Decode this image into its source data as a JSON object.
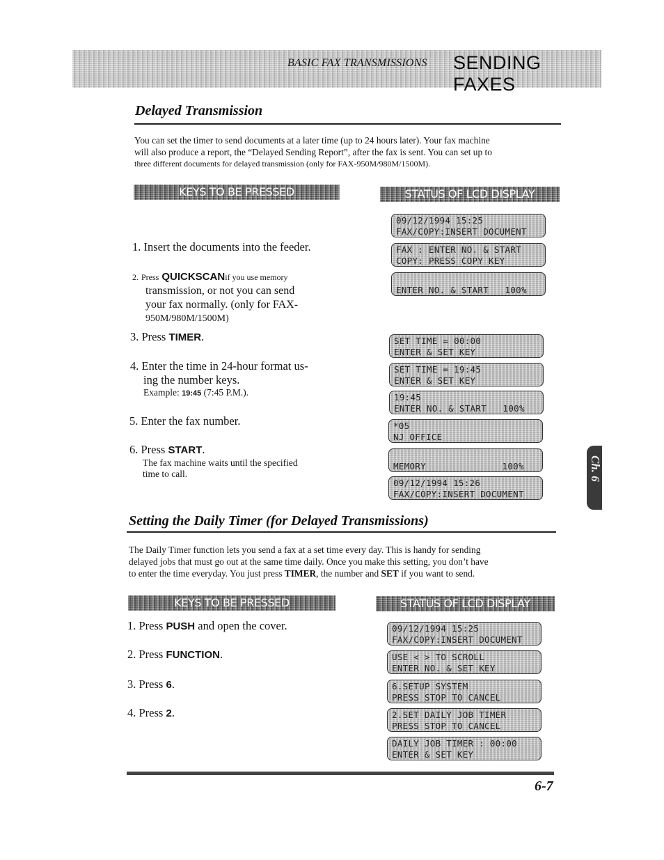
{
  "header": {
    "subtitle": "BASIC FAX TRANSMISSIONS",
    "title": "SENDING FAXES"
  },
  "section1": {
    "title": "Delayed Transmission",
    "intro_lines": [
      "You can set the timer to send documents at a later time (up to 24 hours later). Your fax machine",
      "will also produce a report, the “Delayed Sending Report”, after the fax is sent.  You can set up to",
      "three different documents for delayed transmission (only for FAX-950M/980M/1500M)."
    ],
    "keys_label": "KEYS TO BE PRESSED",
    "lcd_label": "STATUS OF LCD DISPLAY",
    "steps": [
      {
        "num": "1.",
        "text": "Insert the documents into the feeder."
      },
      {
        "num": "2.",
        "pre": "Press",
        "key": "QUICKSCAN",
        "post": "if you use memory",
        "cont": [
          "transmission, or not you can send",
          "your fax normally. (only for FAX-",
          "950M/980M/1500M)"
        ]
      },
      {
        "num": "3.",
        "pre": "Press",
        "key": "TIMER",
        "post": "."
      },
      {
        "num": "4.",
        "text": "Enter the time in 24-hour format us-",
        "cont": [
          "ing the number keys."
        ],
        "note_pre": "Example:",
        "note_key": "19:45",
        "note_post": "(7:45 P.M.)."
      },
      {
        "num": "5.",
        "text": "Enter the fax number."
      },
      {
        "num": "6.",
        "pre": "Press",
        "key": "START",
        "post": ".",
        "note_lines": [
          "The fax machine waits until the specified",
          "time to call."
        ]
      }
    ],
    "lcd_screens": [
      {
        "line1": "09/12/1994 15:25",
        "line2": "FAX/COPY:INSERT DOCUMENT"
      },
      {
        "line1": "FAX : ENTER NO. & START",
        "line2": "COPY: PRESS COPY KEY"
      },
      {
        "line1": "",
        "line2": "ENTER NO. & START   100%"
      },
      {
        "line1": "SET TIME = 00:00",
        "line2": "ENTER & SET KEY"
      },
      {
        "line1": "SET TIME = 19:45",
        "line2": "ENTER & SET KEY"
      },
      {
        "line1": "19:45",
        "line2": "ENTER NO. & START   100%"
      },
      {
        "line1": "*05",
        "line2": "NJ OFFICE"
      },
      {
        "line1": "",
        "line2": "MEMORY              100%"
      },
      {
        "line1": "09/12/1994 15:26",
        "line2": "FAX/COPY:INSERT DOCUMENT"
      }
    ]
  },
  "section2": {
    "title": "Setting the Daily Timer (for Delayed Transmissions)",
    "intro_lines": [
      "The Daily Timer function lets you send a fax at a set time every day. This is handy for sending",
      "delayed jobs that must go out at the same time daily. Once you make this setting, you don’t have"
    ],
    "intro_last_pre": "to enter the time everyday. You just press",
    "intro_last_key1": "TIMER",
    "intro_last_mid": ", the number and",
    "intro_last_key2": "SET",
    "intro_last_post": "if you want to send.",
    "keys_label": "KEYS TO BE PRESSED",
    "lcd_label": "STATUS OF LCD DISPLAY",
    "steps": [
      {
        "num": "1.",
        "pre": "Press",
        "key": "PUSH",
        "post": "and open the cover."
      },
      {
        "num": "2.",
        "pre": "Press",
        "key": "FUNCTION",
        "post": "."
      },
      {
        "num": "3.",
        "pre": "Press",
        "key": "6",
        "post": "."
      },
      {
        "num": "4.",
        "pre": "Press",
        "key": "2",
        "post": "."
      }
    ],
    "lcd_screens": [
      {
        "line1": "09/12/1994 15:25",
        "line2": "FAX/COPY:INSERT DOCUMENT"
      },
      {
        "line1": "USE < > TO SCROLL",
        "line2": "ENTER NO. & SET KEY"
      },
      {
        "line1": "6.SETUP SYSTEM",
        "line2": "PRESS STOP TO CANCEL"
      },
      {
        "line1": "2.SET DAILY JOB TIMER",
        "line2": "PRESS STOP TO CANCEL"
      },
      {
        "line1": "DAILY JOB TIMER : 00:00",
        "line2": "ENTER & SET KEY"
      }
    ]
  },
  "chapter_tab": "Ch. 6",
  "page_number": "6-7"
}
